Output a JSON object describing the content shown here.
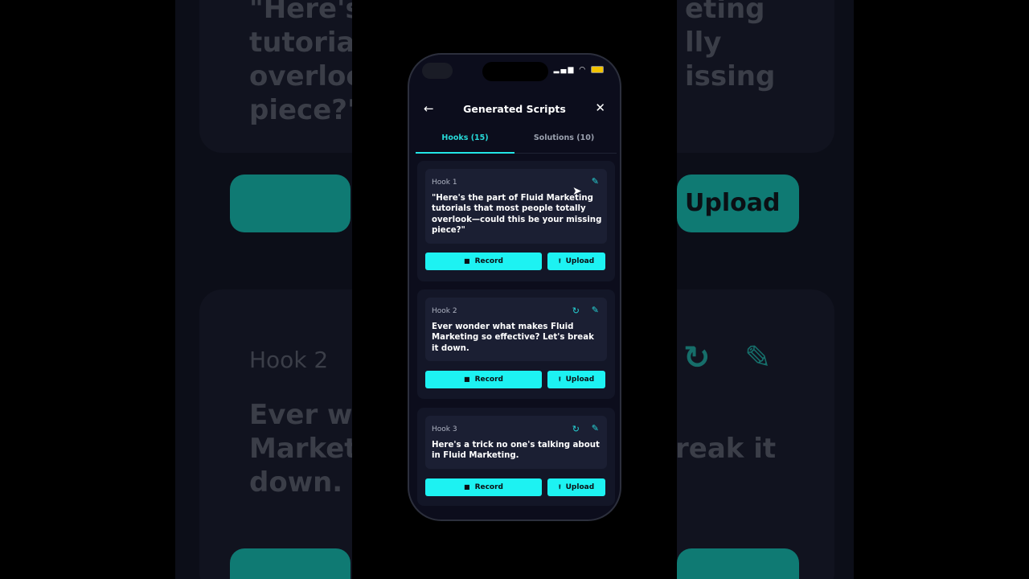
{
  "background": {
    "text_top": "\"Here's\ntutorial\noverloo\npiece?\"",
    "text_top_right": "eting\nlly\nissing",
    "upload_label": "Upload",
    "hook2_label": "Hook 2",
    "hook2_text_left": "Ever wo\nMarketi\ndown.",
    "hook2_text_right": "reak it"
  },
  "status": {
    "signal": "▂▄▆",
    "wifi": "wifi-icon"
  },
  "header": {
    "back_icon": "←",
    "title": "Generated Scripts",
    "close_icon": "✕"
  },
  "tabs": [
    {
      "label": "Hooks (15)",
      "active": true
    },
    {
      "label": "Solutions (10)",
      "active": false
    }
  ],
  "hooks": [
    {
      "label": "Hook 1",
      "text": "\"Here's the part of Fluid Marketing tutorials that most people totally overlook—could this be your missing piece?\"",
      "record_label": "Record",
      "upload_label": "Upload"
    },
    {
      "label": "Hook 2",
      "text": "Ever wonder what makes Fluid Marketing so effective? Let's break it down.",
      "record_label": "Record",
      "upload_label": "Upload"
    },
    {
      "label": "Hook 3",
      "text": "Here's a trick no one's talking about in Fluid Marketing.",
      "record_label": "Record",
      "upload_label": "Upload"
    }
  ],
  "icons": {
    "refresh": "↻",
    "edit": "✎",
    "record": "■",
    "upload": "⭱"
  },
  "colors": {
    "accent": "#1df2f2",
    "background": "#0c0d1c",
    "card": "#131627"
  }
}
